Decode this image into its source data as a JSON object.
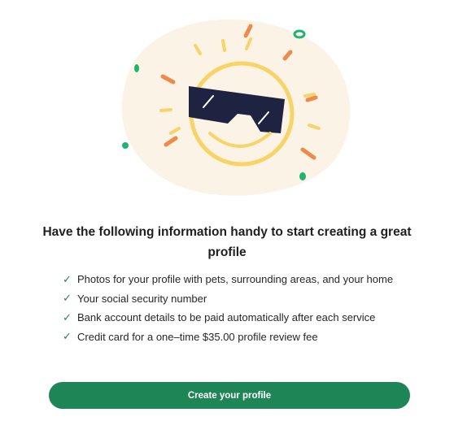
{
  "illustration": {
    "icon": "sun-with-sunglasses-icon",
    "colors": {
      "blob": "#fbf3e6",
      "sun": "#f8d468",
      "sunglasses": "#1f2342",
      "accent_orange": "#f08a4b",
      "accent_green": "#1db56e"
    }
  },
  "heading": "Have the following information handy to start creating a great profile",
  "checklist": {
    "check_icon": "checkmark-icon",
    "items": [
      "Photos for your profile with pets, surrounding areas, and your home",
      "Your social security number",
      "Bank account details to be paid automatically after each service",
      "Credit card for a one–time $35.00 profile review fee"
    ]
  },
  "cta": {
    "label": "Create your profile",
    "color": "#1e8556"
  }
}
